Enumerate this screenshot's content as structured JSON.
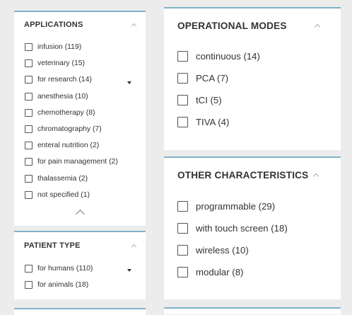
{
  "applications": {
    "title": "APPLICATIONS",
    "items": [
      {
        "label": "infusion (119)"
      },
      {
        "label": "veterinary (15)"
      },
      {
        "label": "for research (14)"
      },
      {
        "label": "anesthesia (10)"
      },
      {
        "label": "chemotherapy (8)"
      },
      {
        "label": "chromatography (7)"
      },
      {
        "label": "enteral nutrition (2)"
      },
      {
        "label": "for pain management (2)"
      },
      {
        "label": "thalassemia (2)"
      },
      {
        "label": "not specified (1)"
      }
    ]
  },
  "patient_type": {
    "title": "PATIENT TYPE",
    "items": [
      {
        "label": "for humans (110)"
      },
      {
        "label": "for animals (18)"
      }
    ]
  },
  "operational_modes": {
    "title": "OPERATIONAL MODES",
    "items": [
      {
        "label": "continuous (14)"
      },
      {
        "label": "PCA (7)"
      },
      {
        "label": "tCI (5)"
      },
      {
        "label": "TIVA (4)"
      }
    ]
  },
  "other_characteristics": {
    "title": "OTHER CHARACTERISTICS",
    "items": [
      {
        "label": "programmable (29)"
      },
      {
        "label": "with touch screen (18)"
      },
      {
        "label": "wireless (10)"
      },
      {
        "label": "modular (8)"
      }
    ]
  },
  "icons": {
    "collapse": "chevron-up-icon",
    "scroll": "scroll-down-arrow-icon",
    "show_less": "chevron-up-icon",
    "checkbox": "checkbox-unchecked"
  },
  "colors": {
    "panel_accent": "#7fb3c7",
    "background": "#ececec",
    "panel_bg": "#ffffff"
  }
}
